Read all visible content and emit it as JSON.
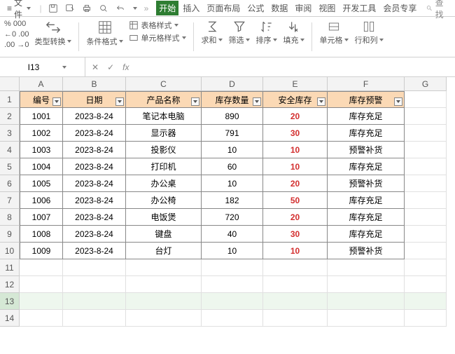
{
  "menubar": {
    "file_label": "文件",
    "tabs": [
      "开始",
      "插入",
      "页面布局",
      "公式",
      "数据",
      "审阅",
      "视图",
      "开发工具",
      "会员专享"
    ],
    "active_tab": 0,
    "search_label": "查找"
  },
  "ribbon": {
    "decimals": [
      "% 000",
      "←0 .00",
      ".00 →0"
    ],
    "type_convert": "类型转换",
    "cond_format": "条件格式",
    "table_style": "表格样式",
    "cell_style": "单元格样式",
    "sum": "求和",
    "filter": "筛选",
    "sort": "排序",
    "fill": "填充",
    "cells": "单元格",
    "rowcol": "行和列"
  },
  "namebox": {
    "value": "I13"
  },
  "columns": [
    "A",
    "B",
    "C",
    "D",
    "E",
    "F",
    "G"
  ],
  "headers": [
    "编号",
    "日期",
    "产品名称",
    "库存数量",
    "安全库存",
    "库存预警"
  ],
  "rows": [
    {
      "id": "1001",
      "date": "2023-8-24",
      "name": "笔记本电脑",
      "qty": "890",
      "safe": "20",
      "warn": "库存充足"
    },
    {
      "id": "1002",
      "date": "2023-8-24",
      "name": "显示器",
      "qty": "791",
      "safe": "30",
      "warn": "库存充足"
    },
    {
      "id": "1003",
      "date": "2023-8-24",
      "name": "投影仪",
      "qty": "10",
      "safe": "10",
      "warn": "预警补货"
    },
    {
      "id": "1004",
      "date": "2023-8-24",
      "name": "打印机",
      "qty": "60",
      "safe": "10",
      "warn": "库存充足"
    },
    {
      "id": "1005",
      "date": "2023-8-24",
      "name": "办公桌",
      "qty": "10",
      "safe": "20",
      "warn": "预警补货"
    },
    {
      "id": "1006",
      "date": "2023-8-24",
      "name": "办公椅",
      "qty": "182",
      "safe": "50",
      "warn": "库存充足"
    },
    {
      "id": "1007",
      "date": "2023-8-24",
      "name": "电饭煲",
      "qty": "720",
      "safe": "20",
      "warn": "库存充足"
    },
    {
      "id": "1008",
      "date": "2023-8-24",
      "name": "键盘",
      "qty": "40",
      "safe": "30",
      "warn": "库存充足"
    },
    {
      "id": "1009",
      "date": "2023-8-24",
      "name": "台灯",
      "qty": "10",
      "safe": "10",
      "warn": "预警补货"
    }
  ],
  "selected": {
    "row": 13,
    "col": "I"
  }
}
